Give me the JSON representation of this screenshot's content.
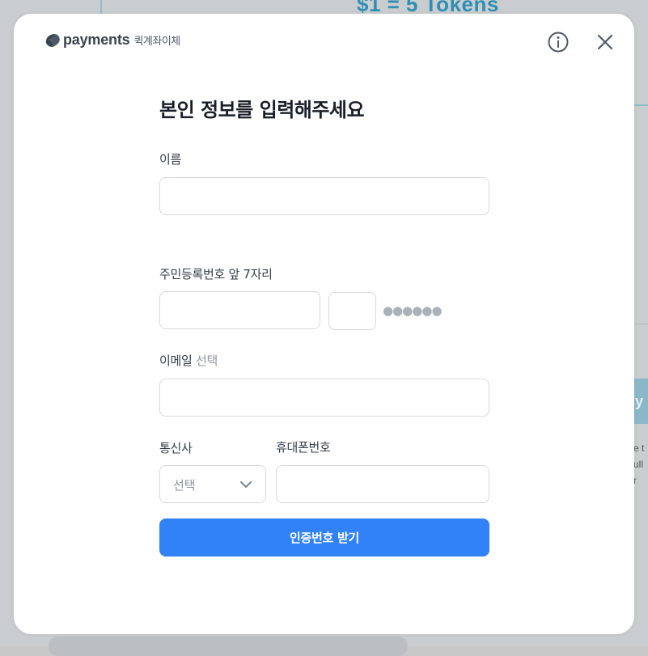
{
  "background": {
    "headline": "$1 = 5 Tokens",
    "right_button_fragment": "y",
    "right_text_lines": [
      "e t",
      "ull r"
    ]
  },
  "modal": {
    "brand": {
      "name": "payments",
      "subtitle": "퀵계좌이체"
    },
    "icons": {
      "info": "info-icon",
      "close": "close-icon",
      "dropdown": "chevron-down-icon"
    },
    "title": "본인 정보를 입력해주세요",
    "fields": {
      "name": {
        "label": "이름",
        "value": "",
        "placeholder": ""
      },
      "rrn": {
        "label": "주민등록번호 앞 7자리",
        "front_value": "",
        "digit_value": "",
        "masked": "●●●●●●"
      },
      "email": {
        "label": "이메일",
        "optional": "선택",
        "value": "",
        "placeholder": ""
      },
      "carrier": {
        "label": "통신사",
        "selected": "선택"
      },
      "phone": {
        "label": "휴대폰번호",
        "value": "",
        "placeholder": ""
      }
    },
    "submit_label": "인증번호 받기"
  },
  "colors": {
    "primary": "#3182f6",
    "title_text": "#191f28",
    "label_text": "#333d4b",
    "muted_text": "#8b95a1",
    "border": "#d5d9de",
    "overlay": "#c9cdcf"
  }
}
